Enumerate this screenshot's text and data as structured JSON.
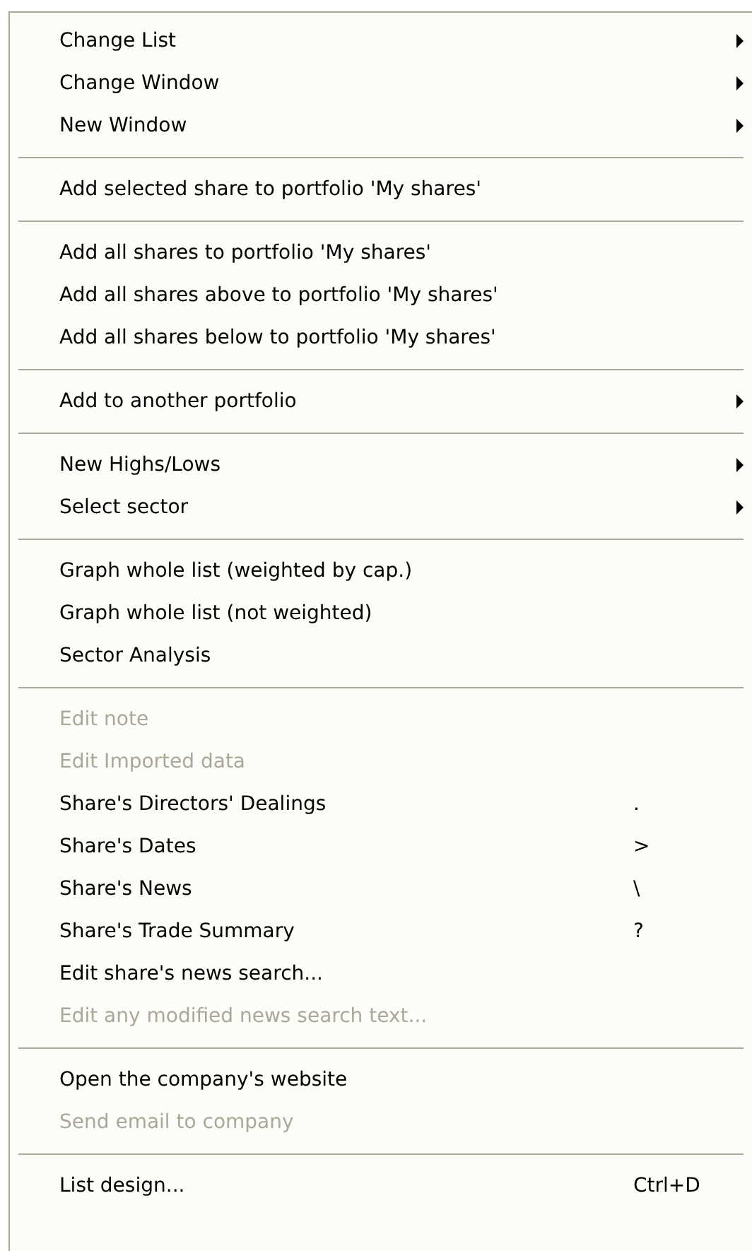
{
  "menu": {
    "groups": [
      {
        "items": [
          {
            "label": "Change List",
            "kind": "submenu",
            "disabled": false
          },
          {
            "label": "Change Window",
            "kind": "submenu",
            "disabled": false
          },
          {
            "label": "New Window",
            "kind": "submenu",
            "disabled": false
          }
        ]
      },
      {
        "items": [
          {
            "label": "Add selected share to portfolio 'My shares'",
            "kind": "command",
            "disabled": false
          }
        ]
      },
      {
        "items": [
          {
            "label": "Add all shares to portfolio 'My shares'",
            "kind": "command",
            "disabled": false
          },
          {
            "label": "Add all shares above to portfolio 'My shares'",
            "kind": "command",
            "disabled": false
          },
          {
            "label": "Add all shares below to portfolio 'My shares'",
            "kind": "command",
            "disabled": false
          }
        ]
      },
      {
        "items": [
          {
            "label": "Add to another portfolio",
            "kind": "submenu",
            "disabled": false
          }
        ]
      },
      {
        "items": [
          {
            "label": "New Highs/Lows",
            "kind": "submenu",
            "disabled": false
          },
          {
            "label": "Select sector",
            "kind": "submenu",
            "disabled": false
          }
        ]
      },
      {
        "items": [
          {
            "label": "Graph whole list (weighted by cap.)",
            "kind": "command",
            "disabled": false
          },
          {
            "label": "Graph whole list (not weighted)",
            "kind": "command",
            "disabled": false
          },
          {
            "label": "Sector Analysis",
            "kind": "command",
            "disabled": false
          }
        ]
      },
      {
        "items": [
          {
            "label": "Edit note",
            "kind": "command",
            "disabled": true
          },
          {
            "label": "Edit Imported data",
            "kind": "command",
            "disabled": true
          },
          {
            "label": "Share's Directors' Dealings",
            "kind": "command",
            "disabled": false,
            "shortcut": "."
          },
          {
            "label": "Share's Dates",
            "kind": "command",
            "disabled": false,
            "shortcut": ">"
          },
          {
            "label": "Share's News",
            "kind": "command",
            "disabled": false,
            "shortcut": "\\"
          },
          {
            "label": "Share's Trade Summary",
            "kind": "command",
            "disabled": false,
            "shortcut": "?"
          },
          {
            "label": "Edit share's news search...",
            "kind": "command",
            "disabled": false
          },
          {
            "label": "Edit any modified news search text...",
            "kind": "command",
            "disabled": true
          }
        ]
      },
      {
        "items": [
          {
            "label": "Open the company's website",
            "kind": "command",
            "disabled": false
          },
          {
            "label": "Send email to company",
            "kind": "command",
            "disabled": true
          }
        ]
      },
      {
        "items": [
          {
            "label": "List design...",
            "kind": "command",
            "disabled": false,
            "shortcut": "Ctrl+D"
          }
        ]
      }
    ]
  }
}
